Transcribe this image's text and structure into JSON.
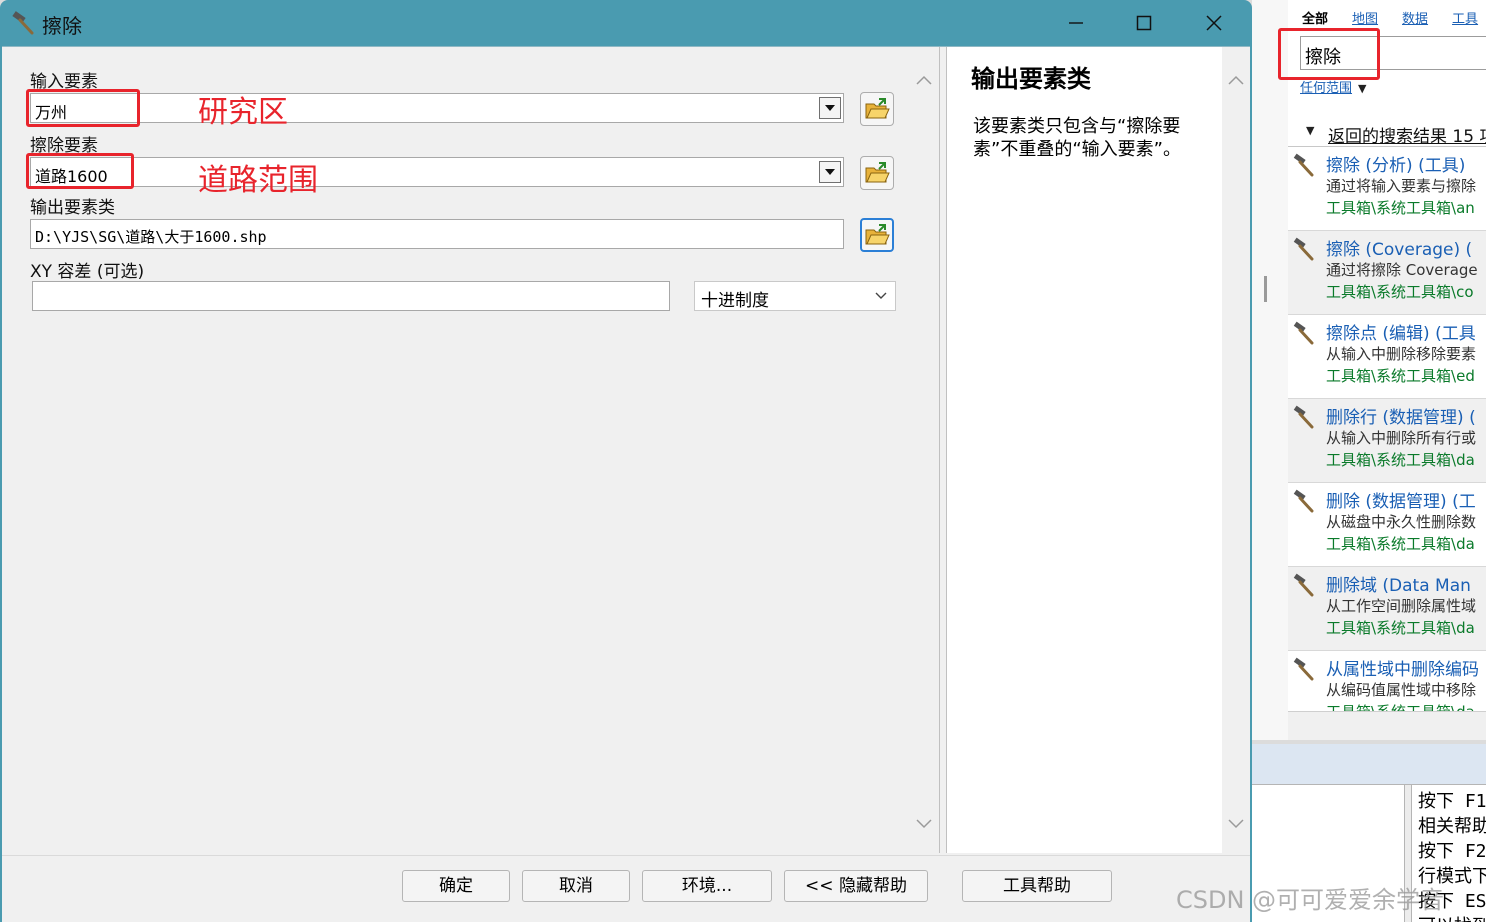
{
  "dialog": {
    "title": "擦除",
    "fields": {
      "input_features": {
        "label": "输入要素",
        "value": "万州"
      },
      "erase_features": {
        "label": "擦除要素",
        "value": "道路1600"
      },
      "output_class": {
        "label": "输出要素类",
        "value": "D:\\YJS\\SG\\道路\\大于1600.shp"
      },
      "xy_tolerance": {
        "label": "XY 容差 (可选)",
        "value": "",
        "unit": "十进制度"
      }
    },
    "annotations": {
      "input": "研究区",
      "erase": "道路范围"
    },
    "help": {
      "title": "输出要素类",
      "text": "该要素类只包含与“擦除要素”不重叠的“输入要素”。"
    },
    "buttons": {
      "ok": "确定",
      "cancel": "取消",
      "environments": "环境...",
      "hide_help": "<< 隐藏帮助",
      "tool_help": "工具帮助"
    }
  },
  "search_panel": {
    "tabs": [
      "全部",
      "地图",
      "数据",
      "工具"
    ],
    "query": "擦除",
    "scope": "任何范围",
    "results_label": "返回的搜索结果 15 项",
    "results": [
      {
        "title": "擦除 (分析) (工具)",
        "desc": "通过将输入要素与擦除",
        "path": "工具箱\\系统工具箱\\an"
      },
      {
        "title": "擦除 (Coverage) (",
        "desc": "通过将擦除 Coverage",
        "path": "工具箱\\系统工具箱\\co"
      },
      {
        "title": "擦除点 (编辑) (工具",
        "desc": "从输入中删除移除要素",
        "path": "工具箱\\系统工具箱\\ed"
      },
      {
        "title": "删除行 (数据管理) (",
        "desc": "从输入中删除所有行或",
        "path": "工具箱\\系统工具箱\\da"
      },
      {
        "title": "删除 (数据管理) (工",
        "desc": "从磁盘中永久性删除数",
        "path": "工具箱\\系统工具箱\\da"
      },
      {
        "title": "删除域 (Data Man",
        "desc": "从工作空间删除属性域",
        "path": "工具箱\\系统工具箱\\da"
      },
      {
        "title": "从属性域中删除编码",
        "desc": "从编码值属性域中移除",
        "path": "工具箱\\系统工具箱\\da"
      }
    ]
  },
  "console": {
    "lines": [
      "按下 F1",
      "相关帮助",
      "按下 F2",
      "行模式下",
      "按下 ES",
      "可以找到"
    ]
  },
  "watermark": "CSDN @可可爱爱余学音",
  "colors": {
    "titlebar": "#4a9bb0",
    "highlight": "#e8242c",
    "link": "#1a5fb4",
    "path": "#0a7a2a"
  }
}
